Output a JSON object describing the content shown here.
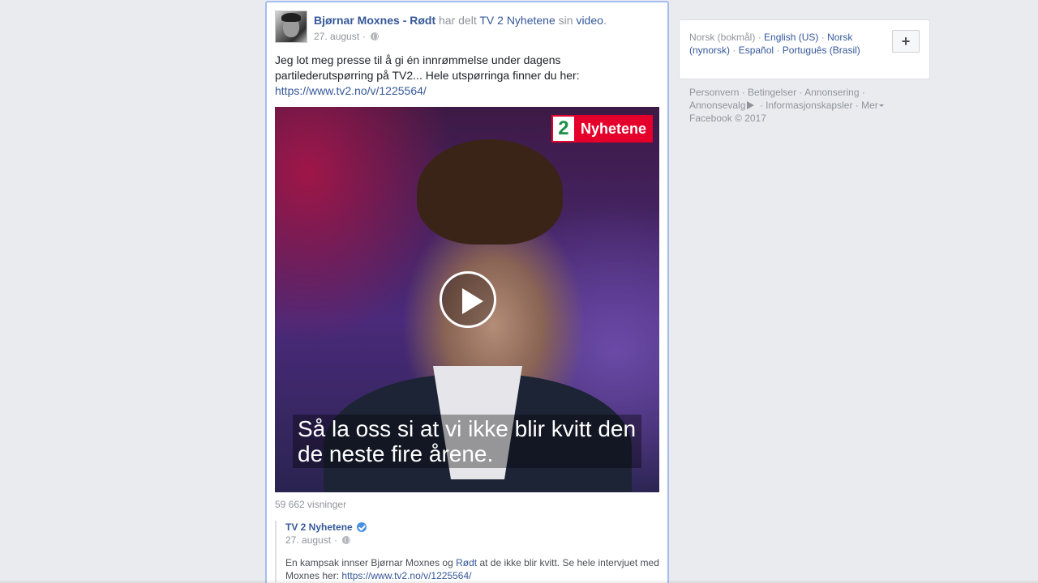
{
  "post": {
    "author": "Bjørnar Moxnes - Rødt",
    "shared_verb": "har delt",
    "shared_page": "TV 2 Nyhetene",
    "shared_possessive": "sin",
    "shared_object": "video",
    "period": ".",
    "date": "27. august",
    "dot": "·",
    "text": "Jeg lot meg presse til å gi én innrømmelse under dagens partilederutspørring på TV2... Hele utspørringa finner du her:",
    "link": "https://www.tv2.no/v/1225564/",
    "video": {
      "logo_number": "2",
      "logo_text": "Nyhetene",
      "subtitle": "Så la oss si at vi ikke blir kvitt den de neste fire årene."
    },
    "views": "59 662 visninger"
  },
  "shared_post": {
    "page_name": "TV 2 Nyhetene",
    "date": "27. august",
    "dot": "·",
    "text_before": "En kampsak innser Bjørnar Moxnes og ",
    "text_link": "Rødt",
    "text_after": " at de ikke blir kvitt. Se hele intervjuet med Moxnes her: ",
    "url": "https://www.tv2.no/v/1225564/"
  },
  "languages": {
    "current": "Norsk (bokmål)",
    "options": [
      "English (US)",
      "Norsk (nynorsk)",
      "Español",
      "Português (Brasil)"
    ],
    "add_label": "+"
  },
  "footer": {
    "links": [
      "Personvern",
      "Betingelser",
      "Annonsering",
      "Annonsevalg",
      "Informasjonskapsler",
      "Mer"
    ],
    "copyright": "Facebook © 2017"
  }
}
